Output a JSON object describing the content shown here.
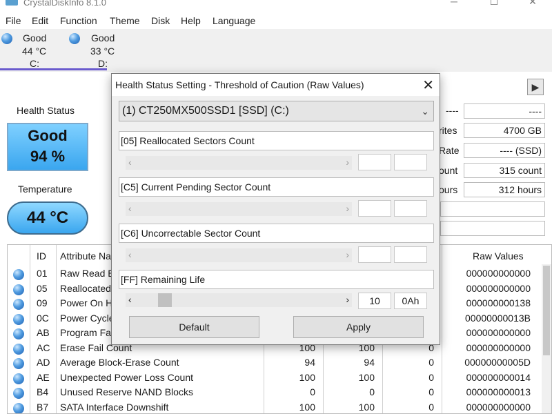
{
  "app": {
    "title": "CrystalDiskInfo 8.1.0"
  },
  "menu": [
    "File",
    "Edit",
    "Function",
    "Theme",
    "Disk",
    "Help",
    "Language"
  ],
  "disks": [
    {
      "status": "Good",
      "temp": "44 °C",
      "letter": "C:"
    },
    {
      "status": "Good",
      "temp": "33 °C",
      "letter": "D:"
    }
  ],
  "health": {
    "label": "Health Status",
    "status": "Good",
    "percent": "94 %"
  },
  "temperature": {
    "label": "Temperature",
    "value": "44 °C"
  },
  "info": [
    {
      "label": "----",
      "value": "----"
    },
    {
      "label": "rites",
      "value": "4700 GB"
    },
    {
      "label": "Rate",
      "value": "---- (SSD)"
    },
    {
      "label": "ount",
      "value": "315 count"
    },
    {
      "label": "ours",
      "value": "312 hours"
    },
    {
      "label": "",
      "value": ""
    },
    {
      "label": "",
      "value": ""
    }
  ],
  "table": {
    "headers": {
      "id": "ID",
      "name": "Attribute Na",
      "raw": "Raw Values"
    },
    "rows": [
      {
        "id": "01",
        "name": "Raw Read E",
        "cur": "",
        "wor": "",
        "thr": "",
        "raw": "000000000000"
      },
      {
        "id": "05",
        "name": "Reallocated",
        "cur": "",
        "wor": "",
        "thr": "",
        "raw": "000000000000"
      },
      {
        "id": "09",
        "name": "Power On H",
        "cur": "",
        "wor": "",
        "thr": "",
        "raw": "000000000138"
      },
      {
        "id": "0C",
        "name": "Power Cycle",
        "cur": "",
        "wor": "",
        "thr": "",
        "raw": "00000000013B"
      },
      {
        "id": "AB",
        "name": "Program Fa",
        "cur": "",
        "wor": "",
        "thr": "",
        "raw": "000000000000"
      },
      {
        "id": "AC",
        "name": "Erase Fail Count",
        "cur": "100",
        "wor": "100",
        "thr": "0",
        "raw": "000000000000"
      },
      {
        "id": "AD",
        "name": "Average Block-Erase Count",
        "cur": "94",
        "wor": "94",
        "thr": "0",
        "raw": "00000000005D"
      },
      {
        "id": "AE",
        "name": "Unexpected Power Loss Count",
        "cur": "100",
        "wor": "100",
        "thr": "0",
        "raw": "000000000014"
      },
      {
        "id": "B4",
        "name": "Unused Reserve NAND Blocks",
        "cur": "0",
        "wor": "0",
        "thr": "0",
        "raw": "000000000013"
      },
      {
        "id": "B7",
        "name": "SATA Interface Downshift",
        "cur": "100",
        "wor": "100",
        "thr": "0",
        "raw": "000000000000"
      }
    ]
  },
  "dialog": {
    "title": "Health Status Setting - Threshold of Caution (Raw Values)",
    "drive": "(1) CT250MX500SSD1 [SSD] (C:)",
    "attrs": [
      {
        "label": "[05] Reallocated Sectors Count",
        "value": "",
        "hex": ""
      },
      {
        "label": "[C5] Current Pending Sector Count",
        "value": "",
        "hex": ""
      },
      {
        "label": "[C6] Uncorrectable Sector Count",
        "value": "",
        "hex": ""
      },
      {
        "label": "[FF] Remaining Life",
        "value": "10",
        "hex": "0Ah"
      }
    ],
    "default_label": "Default",
    "apply_label": "Apply"
  },
  "colors": {
    "accent": "#6a5acd",
    "health_blue": "#3aa6ef"
  }
}
